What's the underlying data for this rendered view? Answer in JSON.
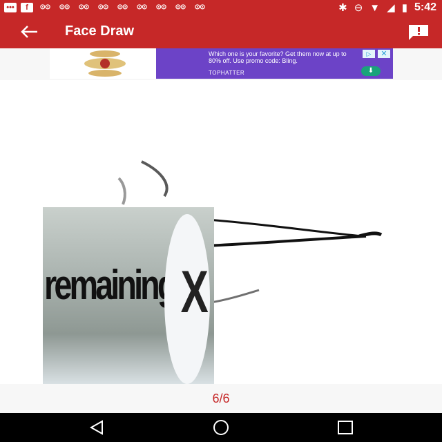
{
  "status_bar": {
    "time": "5:42",
    "left_icons": [
      "chat-icon",
      "facebook-icon",
      "voicemail-icon",
      "voicemail-icon",
      "voicemail-icon",
      "voicemail-icon",
      "voicemail-icon",
      "voicemail-icon",
      "voicemail-icon",
      "voicemail-icon",
      "voicemail-icon"
    ],
    "right_icons": [
      "bluetooth-icon",
      "do-not-disturb-icon",
      "wifi-icon",
      "signal-icon",
      "battery-charging-icon"
    ]
  },
  "app_bar": {
    "title": "Face Draw",
    "back_icon": "arrow-left-icon",
    "report_icon": "feedback-icon",
    "color": "#c62828"
  },
  "ad": {
    "text": "Which one is your favorite? Get them now at up to 80% off. Use promo code: Bling.",
    "brand": "TOPHATTER",
    "background": "#6c43c7"
  },
  "overlay": {
    "word": "remaining",
    "close_glyph": "X"
  },
  "pager": {
    "label": "6/6"
  },
  "nav_bar": {
    "icons": [
      "back-triangle-icon",
      "home-circle-icon",
      "recents-square-icon"
    ]
  }
}
